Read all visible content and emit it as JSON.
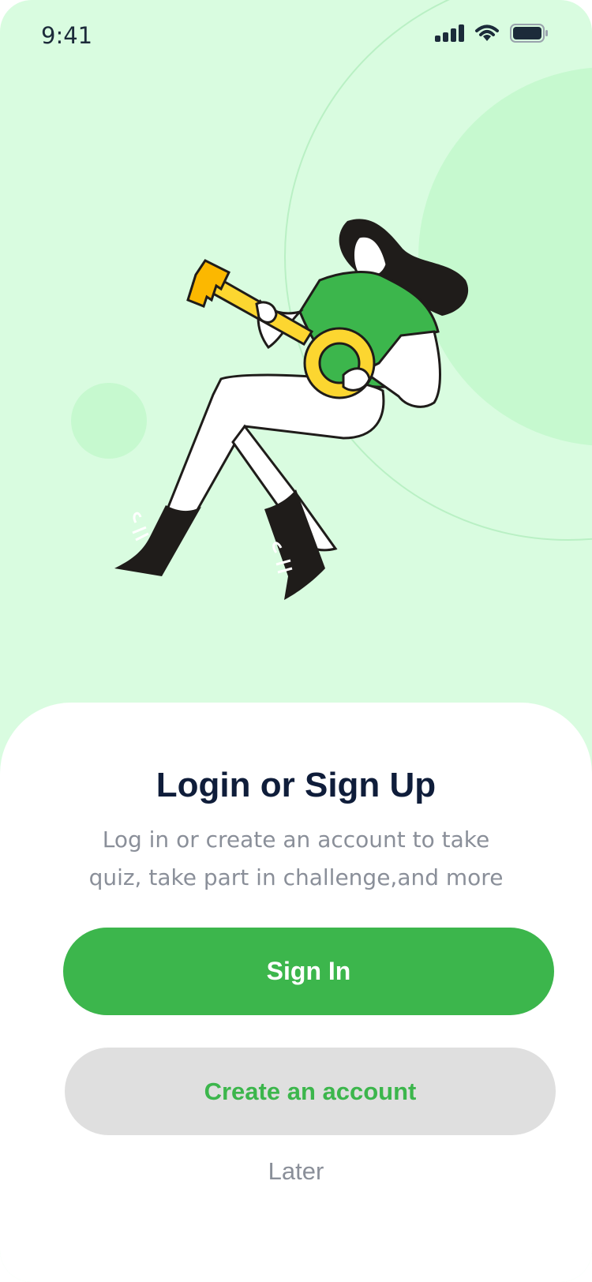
{
  "status_bar": {
    "time": "9:41",
    "icons": [
      "cellular-signal-icon",
      "wifi-icon",
      "battery-icon"
    ]
  },
  "illustration": {
    "subject": "woman-holding-key-illustration"
  },
  "auth": {
    "title": "Login or Sign Up",
    "subtitle": "Log in or create an account to take quiz, take part in challenge,and more",
    "sign_in_label": "Sign In",
    "create_account_label": "Create an account",
    "later_label": "Later"
  },
  "colors": {
    "background": "#d9fce0",
    "accent": "#3cb64c",
    "title": "#0f1d3a",
    "muted_text": "#8a8f99",
    "secondary_button": "#dfdfdf",
    "key_yellow": "#fcd630"
  }
}
